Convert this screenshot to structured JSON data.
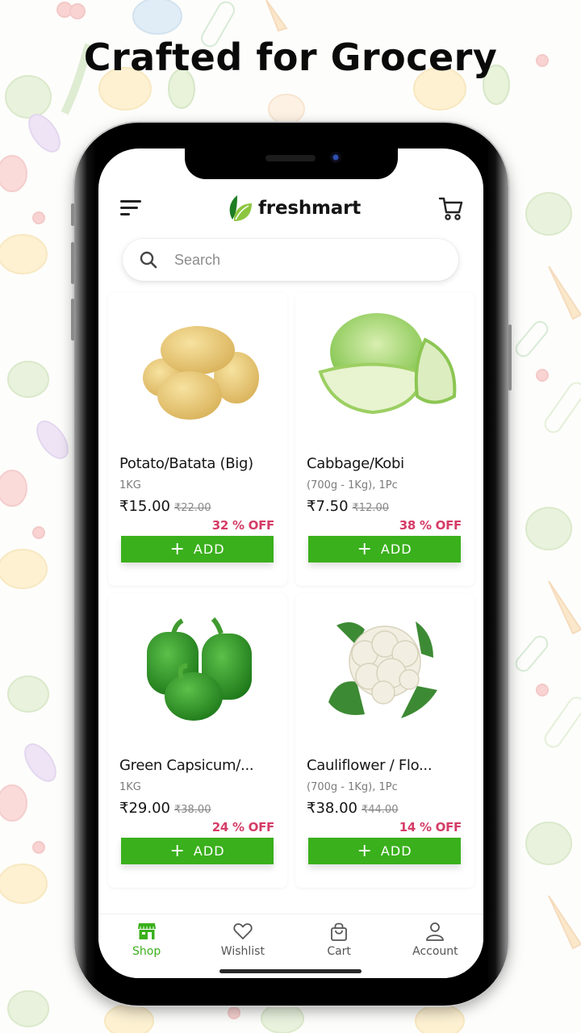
{
  "headline": "Crafted for Grocery",
  "app": {
    "brand": "freshmart",
    "colors": {
      "accent": "#3ab01c",
      "discount": "#d43c66",
      "logo_dark": "#1e7d23",
      "logo_light": "#8cc63f"
    },
    "header": {
      "menu_icon": "hamburger-menu-icon",
      "cart_icon": "shopping-cart-icon"
    },
    "search": {
      "placeholder": "Search",
      "value": "",
      "icon": "search-icon"
    },
    "products": [
      {
        "name": "Potato/Batata (Big)",
        "quantity": "1KG",
        "price": "₹15.00",
        "mrp": "₹22.00",
        "discount": "32 % OFF",
        "add_label": "ADD",
        "image": "potato"
      },
      {
        "name": "Cabbage/Kobi",
        "quantity": "(700g - 1Kg), 1Pc",
        "price": "₹7.50",
        "mrp": "₹12.00",
        "discount": "38 % OFF",
        "add_label": "ADD",
        "image": "cabbage"
      },
      {
        "name": "Green Capsicum/...",
        "quantity": "1KG",
        "price": "₹29.00",
        "mrp": "₹38.00",
        "discount": "24 % OFF",
        "add_label": "ADD",
        "image": "green-capsicum"
      },
      {
        "name": "Cauliflower / Flo...",
        "quantity": "(700g - 1Kg), 1Pc",
        "price": "₹38.00",
        "mrp": "₹44.00",
        "discount": "14 % OFF",
        "add_label": "ADD",
        "image": "cauliflower"
      }
    ],
    "bottom_nav": [
      {
        "label": "Shop",
        "icon": "shop-icon",
        "active": true
      },
      {
        "label": "Wishlist",
        "icon": "heart-icon",
        "active": false
      },
      {
        "label": "Cart",
        "icon": "bag-icon",
        "active": false
      },
      {
        "label": "Account",
        "icon": "user-icon",
        "active": false
      }
    ]
  }
}
